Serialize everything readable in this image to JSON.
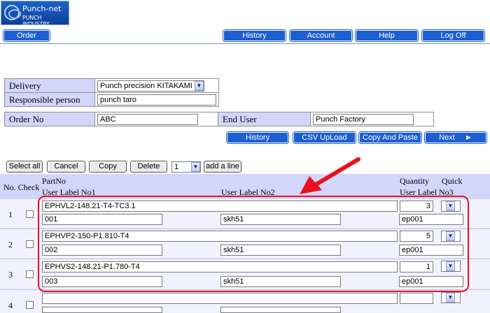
{
  "logo": {
    "line1": "Punch-net",
    "line2": "PUNCH INDUSTRY"
  },
  "nav": {
    "order": "Order",
    "history": "History",
    "account": "Account",
    "help": "Help",
    "logoff": "Log Off"
  },
  "form": {
    "delivery_label": "Delivery",
    "delivery_value": "Punch precision KITAKAMI",
    "responsible_label": "Responsible person",
    "responsible_value": "punch taro",
    "orderno_label": "Order No",
    "orderno_value": "ABC",
    "enduser_label": "End User",
    "enduser_value": "Punch Factory"
  },
  "actions": {
    "history": "History",
    "csv": "CSV UpLoad",
    "copypaste": "Copy And Paste",
    "next": "Next"
  },
  "toolbar": {
    "select_all": "Select all",
    "cancel": "Cancel",
    "copy": "Copy",
    "delete": "Delete",
    "count": "1",
    "add_line": "add a line"
  },
  "table_header": {
    "no_check": "No. Check",
    "partno": "PartNo",
    "label1": "User Label No1",
    "label2": "User Label No2",
    "quantity": "Quantity",
    "quick": "Quick",
    "label3": "User Label No3"
  },
  "rows": [
    {
      "no": "1",
      "partno": "EPHVL2-148.21-T4-TC3.1",
      "qty": "3",
      "label1": "001",
      "label2": "skh51",
      "label3": "ep001"
    },
    {
      "no": "2",
      "partno": "EPHVP2-150-P1.810-T4",
      "qty": "5",
      "label1": "002",
      "label2": "skh51",
      "label3": "ep001"
    },
    {
      "no": "3",
      "partno": "EPHVS2-148.21-P1.780-T4",
      "qty": "1",
      "label1": "003",
      "label2": "skh51",
      "label3": "ep001"
    },
    {
      "no": "4",
      "partno": "",
      "qty": "",
      "label1": "",
      "label2": "",
      "label3": ""
    }
  ],
  "colors": {
    "nav_blue": "#1d5fd0",
    "label_bg": "#d3d6fb",
    "annotation_red": "#e8121f"
  }
}
